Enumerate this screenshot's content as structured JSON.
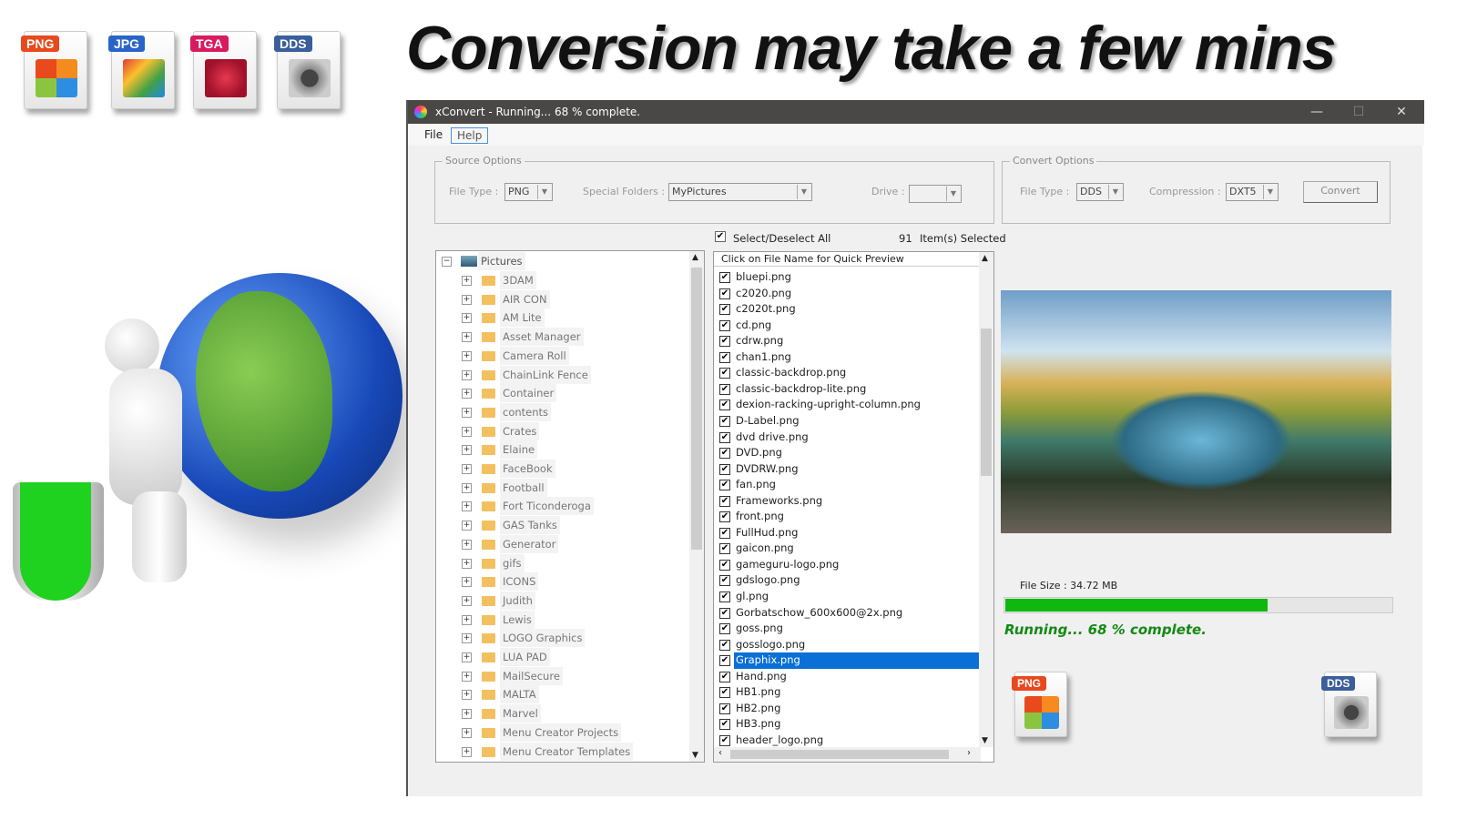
{
  "headline": "Conversion may take a few mins",
  "format_icons": [
    {
      "label": "PNG",
      "color": "#e8491d"
    },
    {
      "label": "JPG",
      "color": "#2a64c8"
    },
    {
      "label": "TGA",
      "color": "#d81b60"
    },
    {
      "label": "DDS",
      "color": "#3a5f9a"
    }
  ],
  "window": {
    "title": "xConvert - Running... 68 % complete.",
    "minimize": "—",
    "maximize": "☐",
    "close": "✕"
  },
  "menu": {
    "file": "File",
    "help": "Help"
  },
  "source_options": {
    "legend": "Source Options",
    "file_type_label": "File Type :",
    "file_type_value": "PNG",
    "special_folders_label": "Special Folders :",
    "special_folders_value": "MyPictures",
    "drive_label": "Drive :",
    "drive_value": ""
  },
  "convert_options": {
    "legend": "Convert Options",
    "file_type_label": "File Type :",
    "file_type_value": "DDS",
    "compression_label": "Compression :",
    "compression_value": "DXT5",
    "convert_button": "Convert"
  },
  "selection": {
    "select_all_label": "Select/Deselect All",
    "select_all_checked": true,
    "count": "91",
    "count_label": "Item(s) Selected"
  },
  "tree": {
    "root": "Pictures",
    "folders": [
      "3DAM",
      "AIR CON",
      "AM Lite",
      "Asset Manager",
      "Camera Roll",
      "ChainLink Fence",
      "Container",
      "contents",
      "Crates",
      "Elaine",
      "FaceBook",
      "Football",
      "Fort Ticonderoga",
      "GAS Tanks",
      "Generator",
      "gifs",
      "ICONS",
      "Judith",
      "Lewis",
      "LOGO Graphics",
      "LUA PAD",
      "MailSecure",
      "MALTA",
      "Marvel",
      "Menu Creator Projects",
      "Menu Creator Templates"
    ]
  },
  "file_list": {
    "header": "Click on File Name for Quick Preview",
    "selected": "Graphix.png",
    "files": [
      "bluepi.png",
      "c2020.png",
      "c2020t.png",
      "cd.png",
      "cdrw.png",
      "chan1.png",
      "classic-backdrop.png",
      "classic-backdrop-lite.png",
      "dexion-racking-upright-column.png",
      "D-Label.png",
      "dvd drive.png",
      "DVD.png",
      "DVDRW.png",
      "fan.png",
      "Frameworks.png",
      "front.png",
      "FullHud.png",
      "gaicon.png",
      "gameguru-logo.png",
      "gdslogo.png",
      "gl.png",
      "Gorbatschow_600x600@2x.png",
      "goss.png",
      "gosslogo.png",
      "Graphix.png",
      "Hand.png",
      "HB1.png",
      "HB2.png",
      "HB3.png",
      "header_logo.png"
    ]
  },
  "status": {
    "file_size": "File Size : 34.72 MB",
    "progress_percent": 68,
    "progress_color": "#0fb80f",
    "running_text": "Running... 68 % complete.",
    "running_color": "#138a13",
    "from_icon": "PNG",
    "to_icon": "DDS"
  }
}
